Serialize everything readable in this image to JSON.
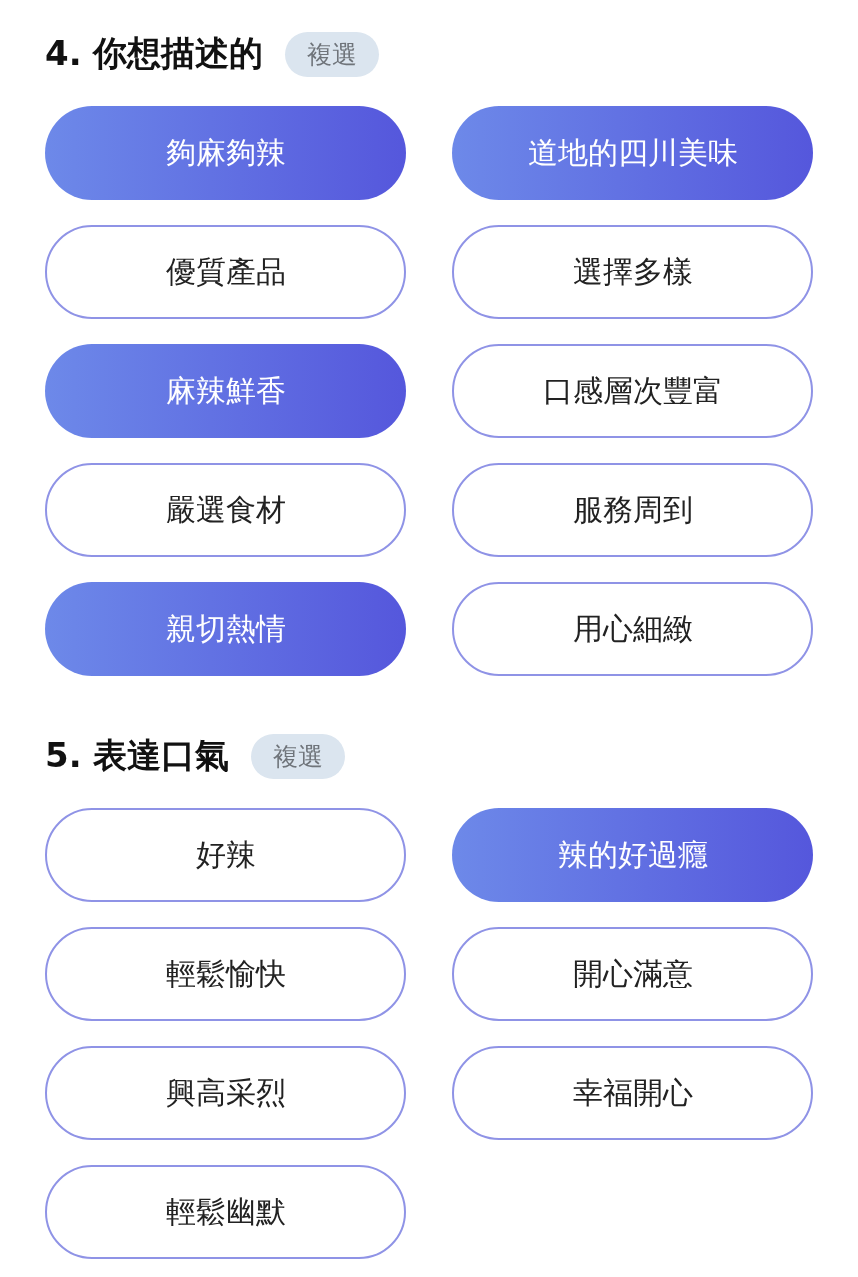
{
  "sections": [
    {
      "title": "4. 你想描述的",
      "badge": "複選",
      "options": [
        {
          "label": "夠麻夠辣",
          "selected": true
        },
        {
          "label": "道地的四川美味",
          "selected": true
        },
        {
          "label": "優質產品",
          "selected": false
        },
        {
          "label": "選擇多樣",
          "selected": false
        },
        {
          "label": "麻辣鮮香",
          "selected": true
        },
        {
          "label": "口感層次豐富",
          "selected": false
        },
        {
          "label": "嚴選食材",
          "selected": false
        },
        {
          "label": "服務周到",
          "selected": false
        },
        {
          "label": "親切熱情",
          "selected": true
        },
        {
          "label": "用心細緻",
          "selected": false
        }
      ]
    },
    {
      "title": "5. 表達口氣",
      "badge": "複選",
      "options": [
        {
          "label": "好辣",
          "selected": false
        },
        {
          "label": "辣的好過癮",
          "selected": true
        },
        {
          "label": "輕鬆愉快",
          "selected": false
        },
        {
          "label": "開心滿意",
          "selected": false
        },
        {
          "label": "興高采烈",
          "selected": false
        },
        {
          "label": "幸福開心",
          "selected": false
        },
        {
          "label": "輕鬆幽默",
          "selected": false
        }
      ]
    }
  ]
}
